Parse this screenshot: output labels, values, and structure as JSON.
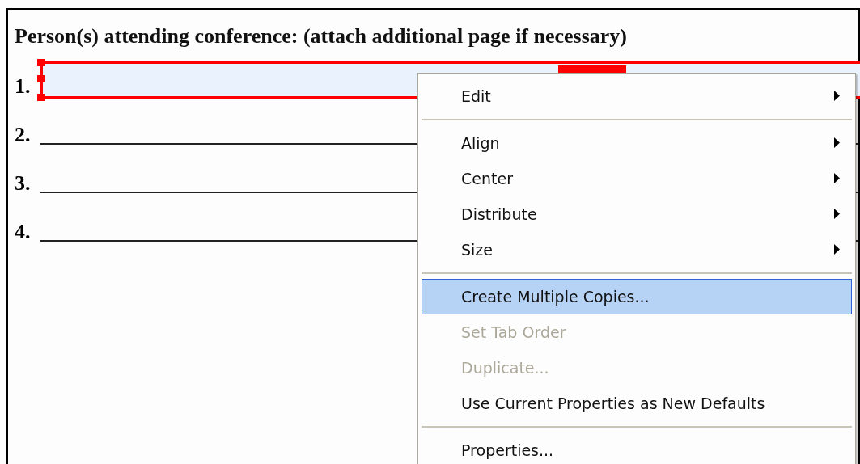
{
  "heading": "Person(s) attending conference: (attach additional page if necessary)",
  "attendees": [
    {
      "number": "1.",
      "selected": true
    },
    {
      "number": "2.",
      "selected": false
    },
    {
      "number": "3.",
      "selected": false
    },
    {
      "number": "4.",
      "selected": false
    }
  ],
  "context_menu": {
    "items": [
      {
        "kind": "item",
        "label": "Edit",
        "submenu": true,
        "disabled": false,
        "selected": false
      },
      {
        "kind": "separator"
      },
      {
        "kind": "item",
        "label": "Align",
        "submenu": true,
        "disabled": false,
        "selected": false
      },
      {
        "kind": "item",
        "label": "Center",
        "submenu": true,
        "disabled": false,
        "selected": false
      },
      {
        "kind": "item",
        "label": "Distribute",
        "submenu": true,
        "disabled": false,
        "selected": false
      },
      {
        "kind": "item",
        "label": "Size",
        "submenu": true,
        "disabled": false,
        "selected": false
      },
      {
        "kind": "separator"
      },
      {
        "kind": "item",
        "label": "Create Multiple Copies...",
        "submenu": false,
        "disabled": false,
        "selected": true
      },
      {
        "kind": "item",
        "label": "Set Tab Order",
        "submenu": false,
        "disabled": true,
        "selected": false
      },
      {
        "kind": "item",
        "label": "Duplicate...",
        "submenu": false,
        "disabled": true,
        "selected": false
      },
      {
        "kind": "item",
        "label": "Use Current Properties as New Defaults",
        "submenu": false,
        "disabled": false,
        "selected": false
      },
      {
        "kind": "separator"
      },
      {
        "kind": "item",
        "label": "Properties...",
        "submenu": false,
        "disabled": false,
        "selected": false
      }
    ]
  }
}
